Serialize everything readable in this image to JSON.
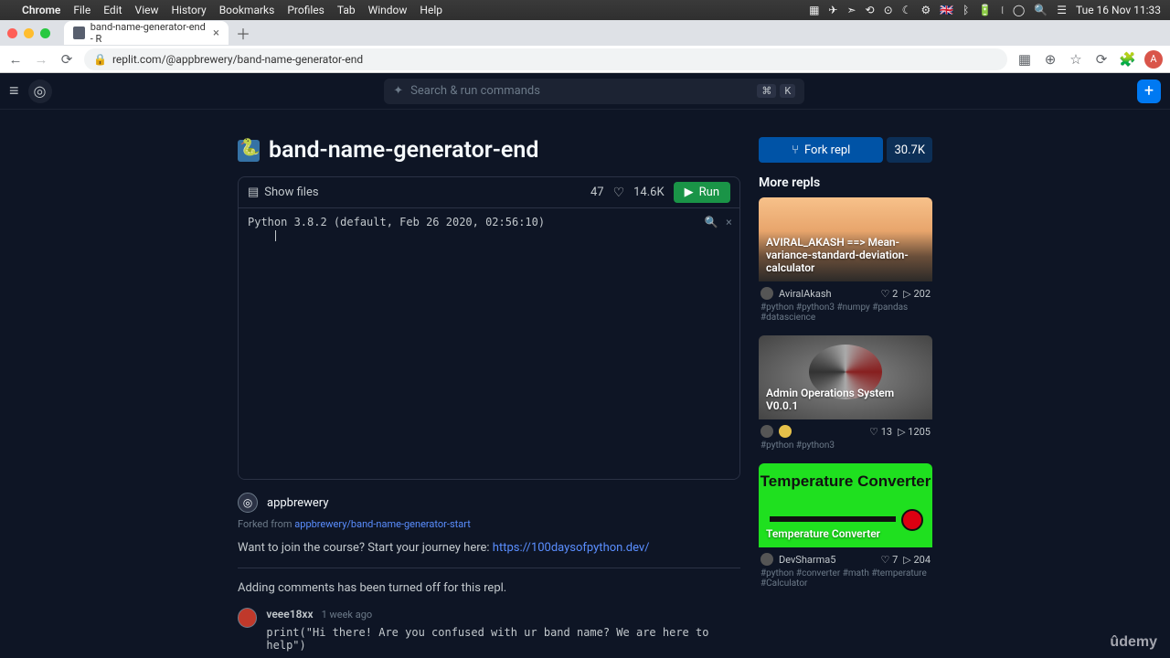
{
  "macos": {
    "app": "Chrome",
    "menus": [
      "File",
      "Edit",
      "View",
      "History",
      "Bookmarks",
      "Profiles",
      "Tab",
      "Window",
      "Help"
    ],
    "right_datetime": "Tue 16 Nov  11:33",
    "flag": "🇬🇧"
  },
  "chrome": {
    "tab_title": "band-name-generator-end - R",
    "url": "replit.com/@appbrewery/band-name-generator-end"
  },
  "search": {
    "placeholder": "Search & run commands",
    "kbd1": "⌘",
    "kbd2": "K"
  },
  "repl": {
    "title": "band-name-generator-end",
    "show_files": "Show files",
    "comment_count": "47",
    "likes": "14.6K",
    "run_label": "Run",
    "console_output": "Python 3.8.2 (default, Feb 26 2020, 02:56:10)"
  },
  "author": {
    "name": "appbrewery",
    "forked_prefix": "Forked from ",
    "forked_link": "appbrewery/band-name-generator-start"
  },
  "desc": {
    "text": "Want to join the course? Start your journey here: ",
    "link": "https://100daysofpython.dev/"
  },
  "comments": {
    "off": "Adding comments has been turned off for this repl.",
    "first": {
      "user": "veee18xx",
      "time": "1 week ago",
      "body": "print(\"Hi there! Are you confused with ur band name? We are here to help\")"
    }
  },
  "fork": {
    "label": "Fork repl",
    "count": "30.7K"
  },
  "more_repls_heading": "More repls",
  "cards": [
    {
      "title": "AVIRAL_AKASH ==> Mean-variance-standard-deviation-calculator",
      "author": "AviralAkash",
      "likes": "2",
      "runs": "202",
      "tags": "#python #python3 #numpy #pandas #datascience"
    },
    {
      "title": "Admin Operations System V0.0.1",
      "author": "",
      "likes": "13",
      "runs": "1205",
      "tags": "#python #python3"
    },
    {
      "title": "Temperature Converter",
      "title_big": "Temperature Converter",
      "author": "DevSharma5",
      "likes": "7",
      "runs": "204",
      "tags": "#python #converter #math #temperature #Calculator"
    }
  ],
  "watermark": "ûdemy"
}
